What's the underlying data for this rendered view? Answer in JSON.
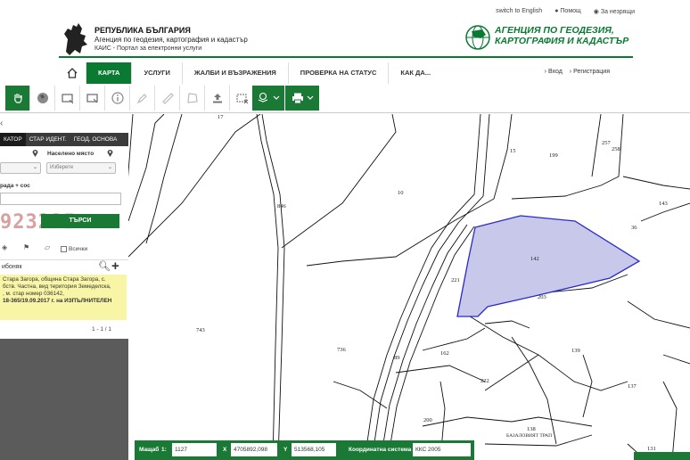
{
  "header": {
    "switch_lang": "switch to English",
    "help": "Помощ",
    "favorites": "За незрящи",
    "republic": "РЕПУБЛИКА БЪЛГАРИЯ",
    "agency_full": "Агенция по геодезия, картография и кадастър",
    "portal": "КАИС - Портал за електронни услуги",
    "agency_logo_text_1": "АГЕНЦИЯ ПО ГЕОДЕЗИЯ,",
    "agency_logo_text_2": "КАРТОГРАФИЯ И КАДАСТЪР"
  },
  "nav": {
    "items": [
      "КАРТА",
      "УСЛУГИ",
      "ЖАЛБИ И ВЪЗРАЖЕНИЯ",
      "ПРОВЕРКА НА СТАТУС",
      "КАК ДА..."
    ],
    "login": "Вход",
    "register": "Регистрация"
  },
  "panel": {
    "close": "‹",
    "tabs": [
      "КАТОР",
      "СТАР ИДЕНТ.",
      "ГЕОД. ОСНОВА"
    ],
    "settlement_label": "Населено място",
    "select_placeholder": "Изберете",
    "number_label": "рада + сос",
    "captcha": "923225",
    "search_button": "ТЪРСИ",
    "all_label": "Всички",
    "result_name": "ибоняк",
    "result_lines": [
      "Стара Загора, община Стара Загора, с.",
      "бств. Частна, вид територия Земеделска,",
      ", м. стар номер 036142,"
    ],
    "result_order": "18-365/19.09.2017 г. на ИЗПЪЛНИТЕЛЕН",
    "pager": "1 - 1 / 1"
  },
  "map": {
    "parcel_labels": [
      "17",
      "10",
      "15",
      "199",
      "257",
      "258",
      "143",
      "36",
      "142",
      "221",
      "203",
      "743",
      "736",
      "162",
      "89",
      "139",
      "137",
      "222",
      "200",
      "138",
      "131",
      "846"
    ],
    "place_label": "БАЗАЛОВИЯТ ТРАП"
  },
  "status": {
    "scale_label": "Мащаб",
    "scale_prefix": "1:",
    "scale_value": "1127",
    "x_label": "X",
    "x_value": "4705892,098",
    "y_label": "Y",
    "y_value": "513568,105",
    "crs_label": "Координатна система",
    "crs_value": "ККС 2005"
  },
  "colors": {
    "accent": "#1a7a35",
    "parcel_fill": "#c8c8ea",
    "parcel_stroke": "#2a2ac8"
  }
}
